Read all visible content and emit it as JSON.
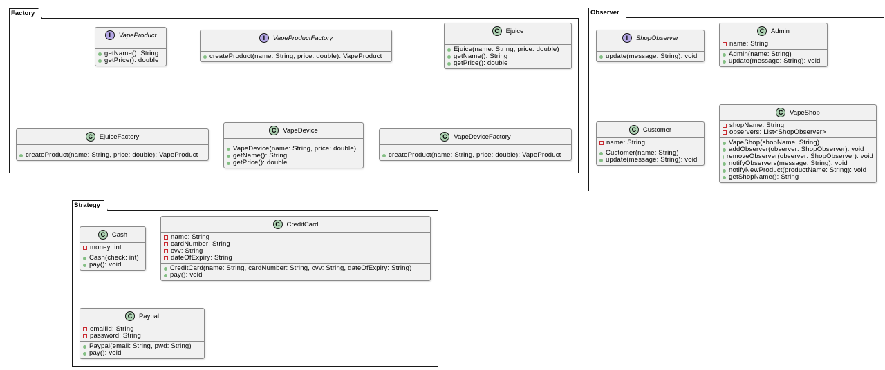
{
  "colors": {
    "class_badge": "#ADD1B2",
    "interface_badge": "#B4A7E5",
    "public": "#84BE84",
    "private": "#C82930"
  },
  "packages": [
    {
      "name": "Factory",
      "classes": [
        {
          "kind": "I",
          "name": "VapeProduct",
          "fields": [],
          "methods": [
            "getName(): String",
            "getPrice(): double"
          ]
        },
        {
          "kind": "I",
          "name": "VapeProductFactory",
          "fields": [],
          "methods": [
            "createProduct(name: String, price: double): VapeProduct"
          ]
        },
        {
          "kind": "C",
          "name": "Ejuice",
          "fields": [],
          "methods": [
            "Ejuice(name: String, price: double)",
            "getName(): String",
            "getPrice(): double"
          ]
        },
        {
          "kind": "C",
          "name": "EjuiceFactory",
          "fields": [],
          "methods": [
            "createProduct(name: String, price: double): VapeProduct"
          ]
        },
        {
          "kind": "C",
          "name": "VapeDevice",
          "fields": [],
          "methods": [
            "VapeDevice(name: String, price: double)",
            "getName(): String",
            "getPrice(): double"
          ]
        },
        {
          "kind": "C",
          "name": "VapeDeviceFactory",
          "fields": [],
          "methods": [
            "createProduct(name: String, price: double): VapeProduct"
          ]
        }
      ]
    },
    {
      "name": "Observer",
      "classes": [
        {
          "kind": "I",
          "name": "ShopObserver",
          "fields": [],
          "methods": [
            "update(message: String): void"
          ]
        },
        {
          "kind": "C",
          "name": "Admin",
          "fields": [
            "name: String"
          ],
          "methods": [
            "Admin(name: String)",
            "update(message: String): void"
          ]
        },
        {
          "kind": "C",
          "name": "Customer",
          "fields": [
            "name: String"
          ],
          "methods": [
            "Customer(name: String)",
            "update(message: String): void"
          ]
        },
        {
          "kind": "C",
          "name": "VapeShop",
          "fields": [
            "shopName: String",
            "observers: List<ShopObserver>"
          ],
          "methods": [
            "VapeShop(shopName: String)",
            "addObserver(observer: ShopObserver): void",
            "removeObserver(observer: ShopObserver): void",
            "notifyObservers(message: String): void",
            "notifyNewProduct(productName: String): void",
            "getShopName(): String"
          ]
        }
      ]
    },
    {
      "name": "Strategy",
      "classes": [
        {
          "kind": "C",
          "name": "Cash",
          "fields": [
            "money: int"
          ],
          "methods": [
            "Cash(check: int)",
            "pay(): void"
          ]
        },
        {
          "kind": "C",
          "name": "CreditCard",
          "fields": [
            "name: String",
            "cardNumber: String",
            "cvv: String",
            "dateOfExpiry: String"
          ],
          "methods": [
            "CreditCard(name: String, cardNumber: String, cvv: String, dateOfExpiry: String)",
            "pay(): void"
          ]
        },
        {
          "kind": "C",
          "name": "Paypal",
          "fields": [
            "emailId: String",
            "password: String"
          ],
          "methods": [
            "Paypal(email: String, pwd: String)",
            "pay(): void"
          ]
        }
      ]
    }
  ]
}
